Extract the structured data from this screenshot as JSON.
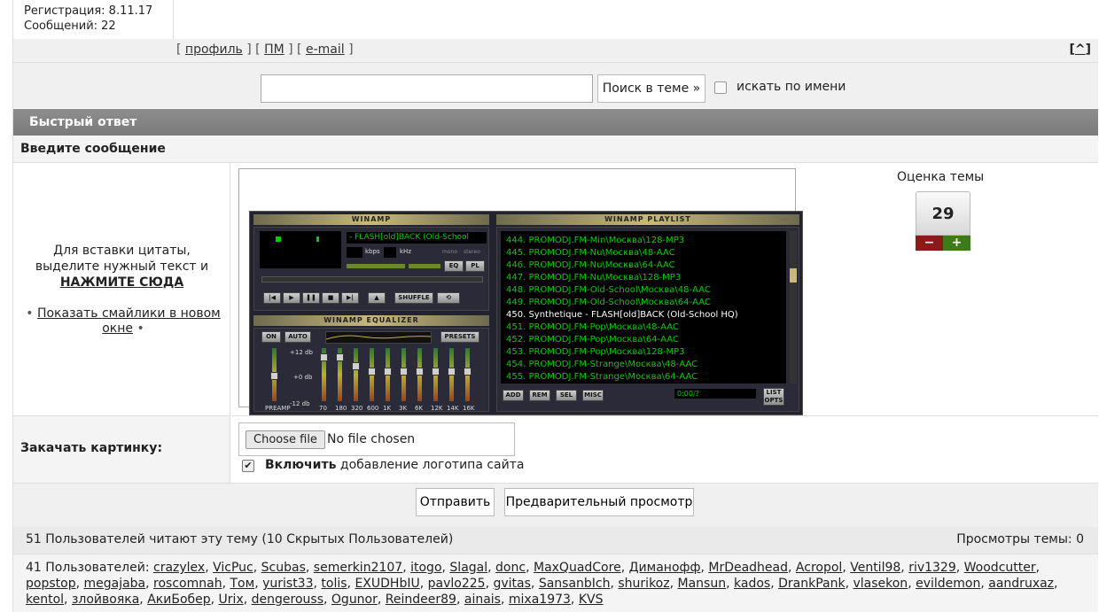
{
  "profile": {
    "registration": "Регистрация: 8.11.17",
    "messages": "Сообщений: 22",
    "links": [
      "профиль",
      "ПМ",
      "e-mail"
    ],
    "top_link": "^"
  },
  "search": {
    "input_value": "",
    "button_label": "Поиск в теме »",
    "checkbox_label": "искать по имени"
  },
  "quick_reply": {
    "header": "Быстрый ответ",
    "message_label": "Введите сообщение",
    "quote_hint_1": "Для вставки цитаты,",
    "quote_hint_2": "выделите нужный текст и",
    "quote_hint_3": "НАЖМИТЕ СЮДА",
    "smiles_link": "Показать смайлики в новом окне"
  },
  "rating": {
    "title": "Оценка темы",
    "value": "29",
    "minus": "−",
    "plus": "+"
  },
  "winamp": {
    "title": "WINAMP",
    "track": "- FLASH[old]BACK (Old-School",
    "kbps": "kbps",
    "khz": "kHz",
    "mono": "mono",
    "stereo": "stereo",
    "eq_btn": "EQ",
    "pl_btn": "PL",
    "shuffle": "SHUFFLE",
    "eq_title": "WINAMP EQUALIZER",
    "eq_on": "ON",
    "eq_auto": "AUTO",
    "eq_presets": "PRESETS",
    "eq_plus": "+12 db",
    "eq_zero": "+0 db",
    "eq_minus": "-12 db",
    "preamp": "PREAMP",
    "bands": [
      "70",
      "180",
      "320",
      "600",
      "1K",
      "3K",
      "6K",
      "12K",
      "14K",
      "16K"
    ],
    "playlist_title": "WINAMP PLAYLIST",
    "playlist": [
      "444. PROMODJ.FM-Min\\Москва\\128-MP3",
      "445. PROMODJ.FM-Nu\\Москва\\48-AAC",
      "446. PROMODJ.FM-Nu\\Москва\\64-AAC",
      "447. PROMODJ.FM-Nu\\Москва\\128-MP3",
      "448. PROMODJ.FM-Old-School\\Москва\\48-AAC",
      "449. PROMODJ.FM-Old-School\\Москва\\64-AAC",
      "450. Synthetique - FLASH[old]BACK (Old-School HQ)",
      "451. PROMODJ.FM-Pop\\Москва\\48-AAC",
      "452. PROMODJ.FM-Pop\\Москва\\64-AAC",
      "453. PROMODJ.FM-Pop\\Москва\\128-MP3",
      "454. PROMODJ.FM-Strange\\Москва\\48-AAC",
      "455. PROMODJ.FM-Strange\\Москва\\64-AAC"
    ],
    "pl_add": "ADD",
    "pl_rem": "REM",
    "pl_sel": "SEL",
    "pl_misc": "MISC",
    "pl_time": "0:00/?",
    "pl_list": "LIST OPTS"
  },
  "upload": {
    "label": "Закачать картинку:",
    "choose_btn": "Choose file",
    "no_file": "No file chosen",
    "logo_bold": "Включить",
    "logo_rest": "добавление логотипа сайта"
  },
  "submit": {
    "send": "Отправить",
    "preview": "Предварительный просмотр"
  },
  "readers": {
    "summary": "51 Пользователей читают эту тему (10 Скрытых Пользователей)",
    "views": "Просмотры темы: 0",
    "users_prefix": "41 Пользователей:",
    "users": [
      "crazylex",
      "VicPuc",
      "Scubas",
      "semerkin2107",
      "itogo",
      "Slagal",
      "donc",
      "MaxQuadCore",
      "Диманофф",
      "MrDeadhead",
      "Acropol",
      "Ventil98",
      "riv1329",
      "Woodcutter",
      "popstop",
      "megajaba",
      "roscomnah",
      "Том",
      "yurist33",
      "tolis",
      "EXUDHbIU",
      "pavlo225",
      "gvitas",
      "SansanbIch",
      "shurikoz",
      "Mansun",
      "kados",
      "DrankPank",
      "vlasekon",
      "evildemon",
      "aandruxaz",
      "kentol",
      "злойвояка",
      "АкиБобер",
      "Urix",
      "dengerouss",
      "Ogunor",
      "Reindeer89",
      "ainais",
      "mixa1973",
      "KVS"
    ]
  }
}
